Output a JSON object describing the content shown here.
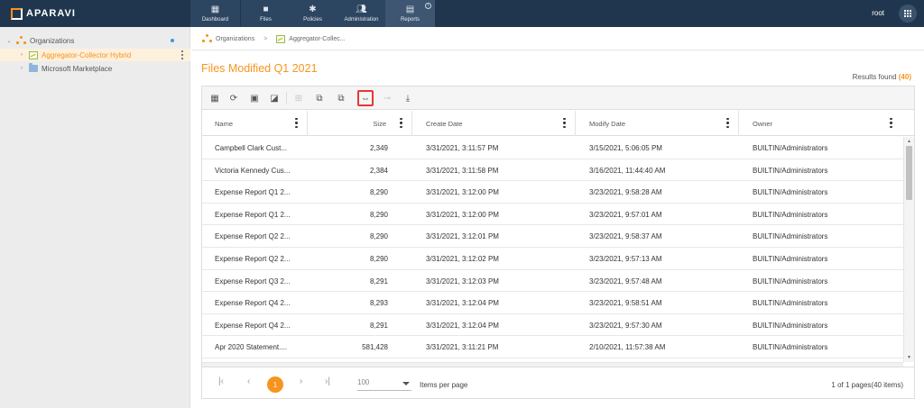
{
  "app": {
    "logo_text": "APARAVI",
    "user": "root"
  },
  "nav": {
    "tabs": [
      {
        "label": "Dashboard",
        "icon": "dashboard-icon"
      },
      {
        "label": "Files",
        "icon": "folder-icon"
      },
      {
        "label": "Policies",
        "icon": "gear-icon"
      },
      {
        "label": "Administration",
        "icon": "users-icon"
      },
      {
        "label": "Reports",
        "icon": "report-icon",
        "active": true
      }
    ]
  },
  "sidebar": {
    "items": [
      {
        "label": "Organizations",
        "icon": "organization-icon"
      },
      {
        "label": "Aggregator-Collector Hybrid",
        "icon": "aggregator-icon",
        "selected": true
      },
      {
        "label": "Microsoft Marketplace",
        "icon": "folder-icon"
      }
    ]
  },
  "breadcrumb": {
    "root": "Organizations",
    "separator": ">",
    "current": "Aggregator-Collec..."
  },
  "page": {
    "title": "Files Modified Q1 2021",
    "results_label": "Results found",
    "results_count": "(40)"
  },
  "toolbar": {
    "buttons": [
      "table-icon",
      "refresh-icon",
      "save-icon",
      "save-as-icon",
      "split-icon",
      "copy-icon",
      "paste-icon",
      "fit-columns-icon",
      "link-icon",
      "download-icon"
    ],
    "highlighted": "fit-columns-icon"
  },
  "table": {
    "columns": [
      "Name",
      "Size",
      "Create Date",
      "Modify Date",
      "Owner"
    ],
    "rows": [
      {
        "name": "Campbell Clark Cust...",
        "size": "2,349",
        "create": "3/31/2021, 3:11:57 PM",
        "modify": "3/15/2021, 5:06:05 PM",
        "owner": "BUILTIN/Administrators"
      },
      {
        "name": "Victoria Kennedy Cus...",
        "size": "2,384",
        "create": "3/31/2021, 3:11:58 PM",
        "modify": "3/16/2021, 11:44:40 AM",
        "owner": "BUILTIN/Administrators"
      },
      {
        "name": "Expense Report Q1 2...",
        "size": "8,290",
        "create": "3/31/2021, 3:12:00 PM",
        "modify": "3/23/2021, 9:58:28 AM",
        "owner": "BUILTIN/Administrators"
      },
      {
        "name": "Expense Report Q1 2...",
        "size": "8,290",
        "create": "3/31/2021, 3:12:00 PM",
        "modify": "3/23/2021, 9:57:01 AM",
        "owner": "BUILTIN/Administrators"
      },
      {
        "name": "Expense Report Q2 2...",
        "size": "8,290",
        "create": "3/31/2021, 3:12:01 PM",
        "modify": "3/23/2021, 9:58:37 AM",
        "owner": "BUILTIN/Administrators"
      },
      {
        "name": "Expense Report Q2 2...",
        "size": "8,290",
        "create": "3/31/2021, 3:12:02 PM",
        "modify": "3/23/2021, 9:57:13 AM",
        "owner": "BUILTIN/Administrators"
      },
      {
        "name": "Expense Report Q3 2...",
        "size": "8,291",
        "create": "3/31/2021, 3:12:03 PM",
        "modify": "3/23/2021, 9:57:48 AM",
        "owner": "BUILTIN/Administrators"
      },
      {
        "name": "Expense Report Q4 2...",
        "size": "8,293",
        "create": "3/31/2021, 3:12:04 PM",
        "modify": "3/23/2021, 9:58:51 AM",
        "owner": "BUILTIN/Administrators"
      },
      {
        "name": "Expense Report Q4 2...",
        "size": "8,291",
        "create": "3/31/2021, 3:12:04 PM",
        "modify": "3/23/2021, 9:57:30 AM",
        "owner": "BUILTIN/Administrators"
      },
      {
        "name": "Apr 2020 Statement....",
        "size": "581,428",
        "create": "3/31/2021, 3:11:21 PM",
        "modify": "2/10/2021, 11:57:38 AM",
        "owner": "BUILTIN/Administrators"
      }
    ]
  },
  "pager": {
    "current_page": "1",
    "items_per_page": "100",
    "items_per_page_label": "Items per page",
    "summary": "1 of 1 pages(40 items)"
  },
  "colors": {
    "accent": "#f7941d",
    "topbar": "#20364f",
    "highlight_border": "#e53935"
  }
}
